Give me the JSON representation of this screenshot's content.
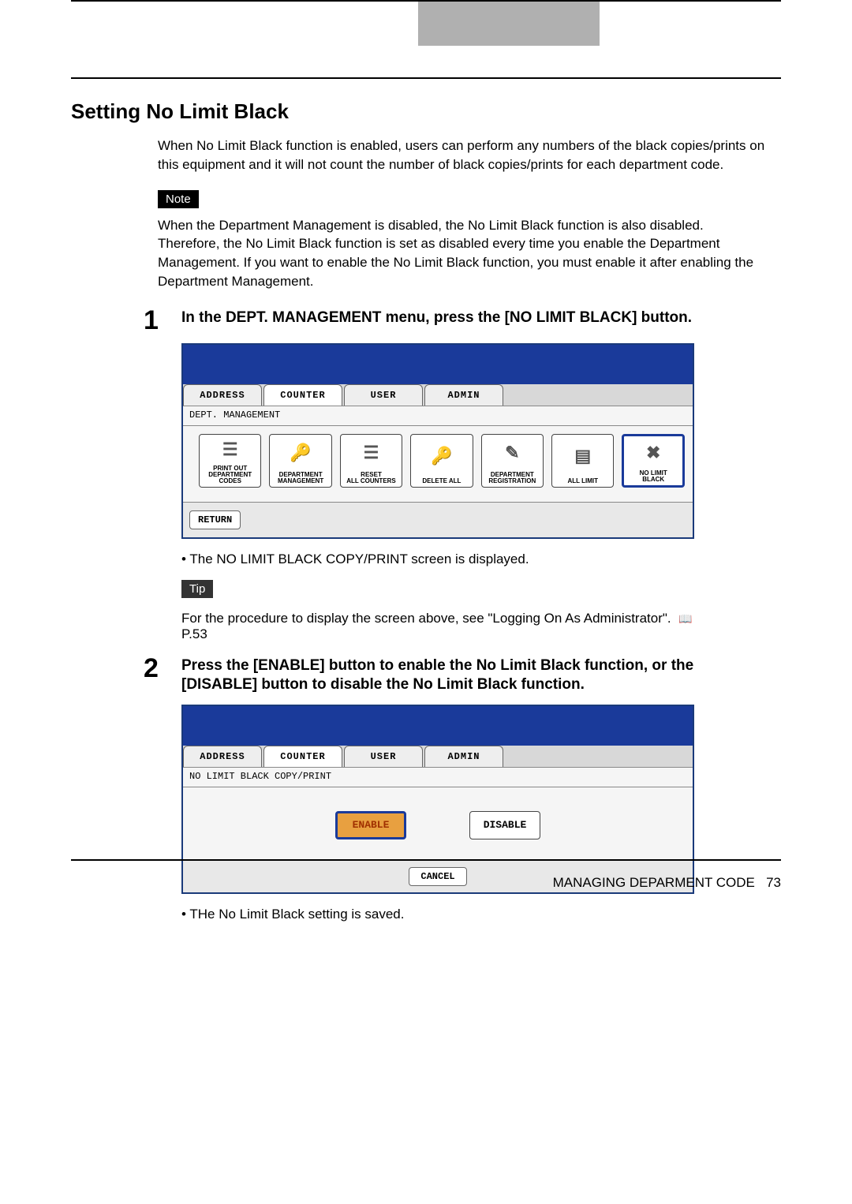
{
  "heading": "Setting No Limit Black",
  "intro": "When No Limit Black function is enabled, users can perform any numbers of the black copies/prints on this equipment and it will not count the number of black copies/prints for each department code.",
  "note_label": "Note",
  "note_text": "When the Department Management is disabled, the No Limit Black function is also disabled. Therefore, the No Limit Black function is set as disabled every time you enable the Department Management.  If you want to enable the No Limit Black function, you must enable it after enabling the Department Management.",
  "step1": {
    "num": "1",
    "text": "In the DEPT. MANAGEMENT menu, press the [NO LIMIT BLACK] button.",
    "bullet": "•  The NO LIMIT BLACK COPY/PRINT screen is displayed."
  },
  "tip_label": "Tip",
  "tip_text": "For the procedure to display the screen above, see \"Logging On As Administrator\".",
  "tip_ref": "P.53",
  "step2": {
    "num": "2",
    "text": "Press the [ENABLE] button to enable the No Limit Black function, or the [DISABLE] button to disable the No Limit Black function.",
    "bullet": "•  THe No Limit Black setting is saved."
  },
  "screenshot1": {
    "tabs": {
      "address": "ADDRESS",
      "counter": "COUNTER",
      "user": "USER",
      "admin": "ADMIN"
    },
    "subtitle": "DEPT. MANAGEMENT",
    "buttons": {
      "b1": "PRINT OUT\nDEPARTMENT CODES",
      "b2": "DEPARTMENT\nMANAGEMENT",
      "b3": "RESET\nALL COUNTERS",
      "b4": "DELETE ALL",
      "b5": "DEPARTMENT\nREGISTRATION",
      "b6": "ALL LIMIT",
      "b7": "NO LIMIT\nBLACK"
    },
    "return": "RETURN"
  },
  "screenshot2": {
    "tabs": {
      "address": "ADDRESS",
      "counter": "COUNTER",
      "user": "USER",
      "admin": "ADMIN"
    },
    "subtitle": "NO LIMIT BLACK COPY/PRINT",
    "enable": "ENABLE",
    "disable": "DISABLE",
    "cancel": "CANCEL"
  },
  "footer": {
    "text": "MANAGING DEPARMENT CODE",
    "page": "73"
  }
}
